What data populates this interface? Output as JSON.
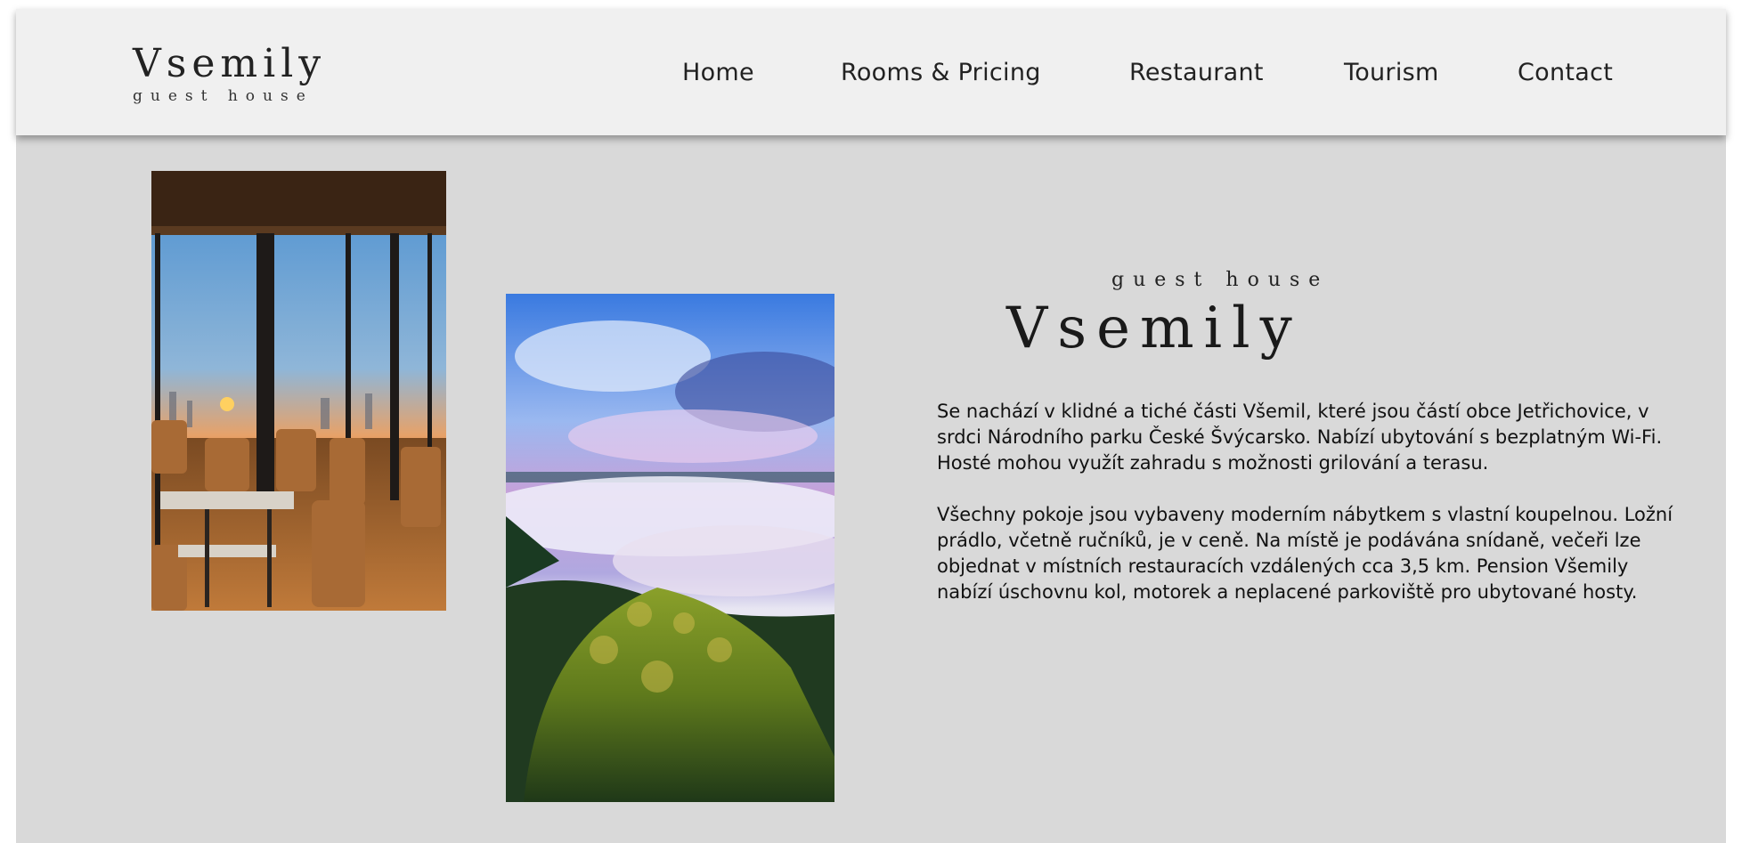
{
  "site": {
    "logo_name": "Vsemily",
    "logo_sub": "guest house"
  },
  "nav": {
    "home": "Home",
    "rooms": "Rooms & Pricing",
    "restaurant": "Restaurant",
    "tourism": "Tourism",
    "contact": "Contact"
  },
  "hero": {
    "subtitle": "guest house",
    "title": "Vsemily",
    "paragraphs": [
      "Se nachází v klidné a tiché části Všemil, které jsou částí obce Jetřichovice, v srdci Národního parku České Švýcarsko. Nabízí ubytování s bezplatným Wi-Fi. Hosté mohou využít zahradu s možnosti grilování a terasu.",
      "Všechny pokoje jsou vybaveny moderním nábytkem s vlastní koupelnou. Ložní prádlo, včetně ručníků, je v ceně. Na místě je podávána snídaně, večeři lze objednat v místních restauracích vzdálených cca 3,5 km. Pension Všemily nabízí úschovnu kol, motorek a neplacené parkoviště pro ubytované hosty."
    ]
  },
  "images": {
    "restaurant": "restaurant-sunset-photo",
    "landscape": "misty-forest-landscape-photo"
  },
  "colors": {
    "header_bg": "#f0f0f0",
    "content_bg": "#d9d9d9",
    "text": "#222222"
  }
}
